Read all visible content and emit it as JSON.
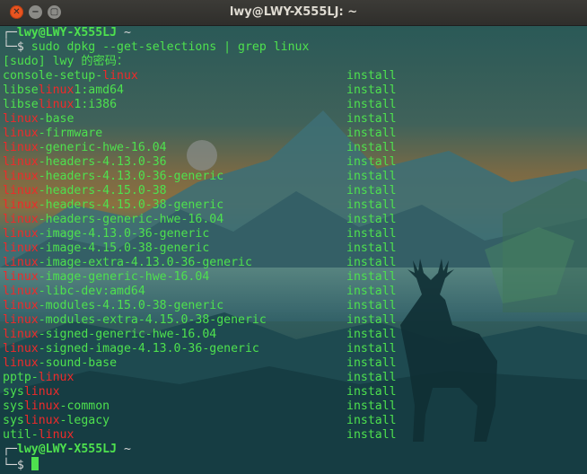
{
  "window": {
    "title": "lwy@LWY-X555LJ: ~"
  },
  "terminal": {
    "prompt1": {
      "corner": "┌─",
      "user": "lwy@LWY-X555LJ",
      "cwd": "~",
      "arrow": "└─$",
      "command": "sudo dpkg --get-selections | grep linux"
    },
    "sudo_prompt": "[sudo] lwy 的密码：",
    "status_word": "install",
    "packages": [
      {
        "pre": "console-setup-",
        "hl": "linux",
        "post": ""
      },
      {
        "pre": "libse",
        "hl": "linux",
        "post": "1:amd64"
      },
      {
        "pre": "libse",
        "hl": "linux",
        "post": "1:i386"
      },
      {
        "pre": "",
        "hl": "linux",
        "post": "-base"
      },
      {
        "pre": "",
        "hl": "linux",
        "post": "-firmware"
      },
      {
        "pre": "",
        "hl": "linux",
        "post": "-generic-hwe-16.04"
      },
      {
        "pre": "",
        "hl": "linux",
        "post": "-headers-4.13.0-36"
      },
      {
        "pre": "",
        "hl": "linux",
        "post": "-headers-4.13.0-36-generic"
      },
      {
        "pre": "",
        "hl": "linux",
        "post": "-headers-4.15.0-38"
      },
      {
        "pre": "",
        "hl": "linux",
        "post": "-headers-4.15.0-38-generic"
      },
      {
        "pre": "",
        "hl": "linux",
        "post": "-headers-generic-hwe-16.04"
      },
      {
        "pre": "",
        "hl": "linux",
        "post": "-image-4.13.0-36-generic"
      },
      {
        "pre": "",
        "hl": "linux",
        "post": "-image-4.15.0-38-generic"
      },
      {
        "pre": "",
        "hl": "linux",
        "post": "-image-extra-4.13.0-36-generic"
      },
      {
        "pre": "",
        "hl": "linux",
        "post": "-image-generic-hwe-16.04"
      },
      {
        "pre": "",
        "hl": "linux",
        "post": "-libc-dev:amd64"
      },
      {
        "pre": "",
        "hl": "linux",
        "post": "-modules-4.15.0-38-generic"
      },
      {
        "pre": "",
        "hl": "linux",
        "post": "-modules-extra-4.15.0-38-generic"
      },
      {
        "pre": "",
        "hl": "linux",
        "post": "-signed-generic-hwe-16.04"
      },
      {
        "pre": "",
        "hl": "linux",
        "post": "-signed-image-4.13.0-36-generic"
      },
      {
        "pre": "",
        "hl": "linux",
        "post": "-sound-base"
      },
      {
        "pre": "pptp-",
        "hl": "linux",
        "post": ""
      },
      {
        "pre": "sys",
        "hl": "linux",
        "post": ""
      },
      {
        "pre": "sys",
        "hl": "linux",
        "post": "-common"
      },
      {
        "pre": "sys",
        "hl": "linux",
        "post": "-legacy"
      },
      {
        "pre": "util-",
        "hl": "linux",
        "post": ""
      }
    ],
    "prompt2": {
      "corner": "┌─",
      "user": "lwy@LWY-X555LJ",
      "cwd": "~",
      "arrow": "└─$"
    }
  },
  "colors": {
    "prompt": "#4ee14e",
    "highlight": "#ef2a2a",
    "titlebar": "#3c3b37",
    "close": "#e95420"
  }
}
